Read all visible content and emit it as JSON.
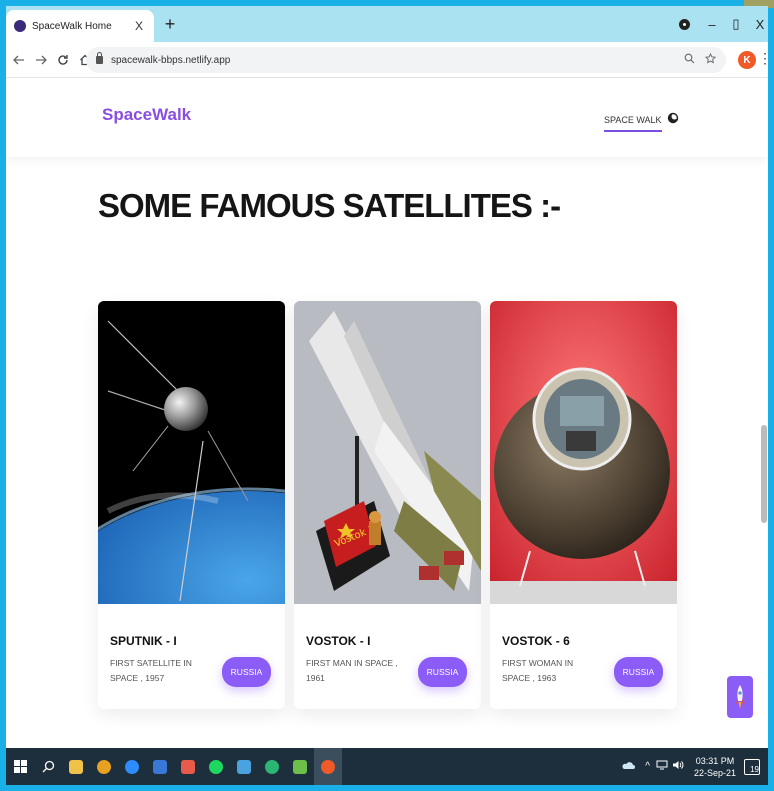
{
  "browser": {
    "tab_title": "SpaceWalk Home",
    "tab_close": "X",
    "new_tab": "+",
    "url": "spacewalk-bbps.netlify.app",
    "profile_initial": "K",
    "window_minimize": "–",
    "window_restore": "▯",
    "window_close": "X"
  },
  "site": {
    "brand": "SpaceWalk",
    "nav_link": "SPACE WALK",
    "section_heading": "SOME FAMOUS SATELLITES :-"
  },
  "cards": [
    {
      "title": "SPUTNIK - I",
      "description": "FIRST SATELLITE IN SPACE , 1957",
      "button": "RUSSIA"
    },
    {
      "title": "VOSTOK - I",
      "description": "FIRST MAN IN SPACE , 1961",
      "button": "RUSSIA",
      "image_text": "Vostok 1"
    },
    {
      "title": "VOSTOK - 6",
      "description": "FIRST WOMAN IN SPACE , 1963",
      "button": "RUSSIA"
    }
  ],
  "taskbar": {
    "time": "03:31 PM",
    "date": "22-Sep-21",
    "notification_count": "19"
  },
  "colors": {
    "accent": "#8b5cf6",
    "brand": "#8a4fe0",
    "tabstrip": "#abe2f2",
    "taskbar": "#1d2f3d"
  }
}
